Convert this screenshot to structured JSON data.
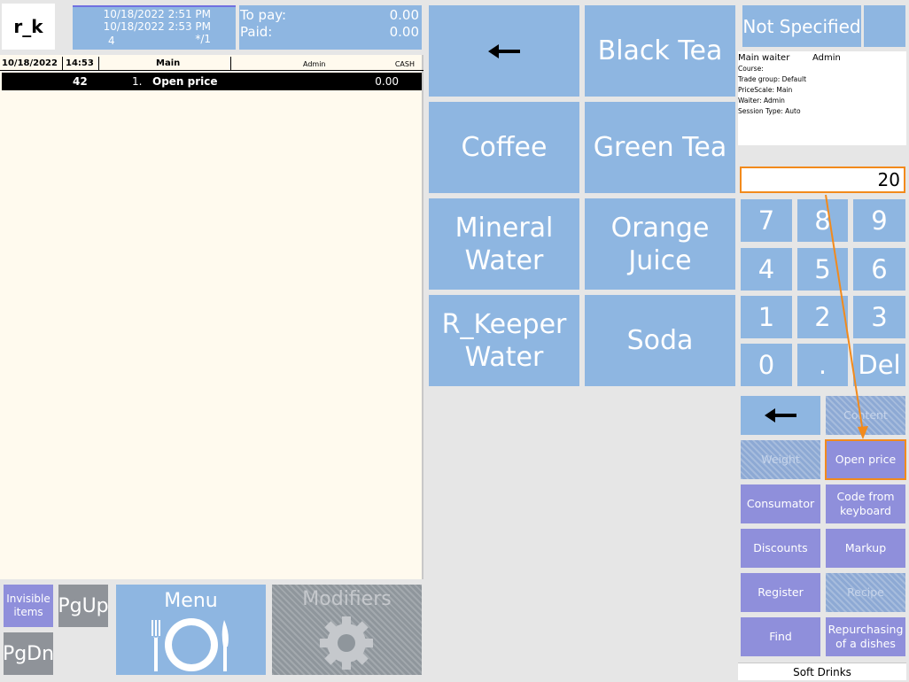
{
  "logo": "r_k",
  "header": {
    "opened": "10/18/2022 2:51 PM",
    "printed": "10/18/2022 2:53 PM",
    "table": "4",
    "guests": "*/1",
    "to_pay_label": "To pay:",
    "to_pay_value": "0.00",
    "paid_label": "Paid:",
    "paid_value": "0.00"
  },
  "order": {
    "header": {
      "date": "10/18/2022",
      "time": "14:53",
      "menu": "Main",
      "waiter": "Admin",
      "currency": "CASH"
    },
    "rows": [
      {
        "code": "42",
        "num": "1.",
        "name": "Open price",
        "price": "0.00"
      }
    ]
  },
  "bottom_left": {
    "invisible_items": "Invisible items",
    "pgup": "PgUp",
    "pgdn": "PgDn",
    "menu": "Menu",
    "modifiers": "Modifiers"
  },
  "menu_items": {
    "back_icon": "arrow-left-icon",
    "black_tea": "Black Tea",
    "coffee": "Coffee",
    "green_tea": "Green Tea",
    "mineral_water": "Mineral Water",
    "orange_juice": "Orange Juice",
    "rkeeper_water": "R_Keeper Water",
    "soda": "Soda"
  },
  "info": {
    "not_specified": "Not Specified",
    "main_waiter_label": "Main waiter",
    "main_waiter_value": "Admin",
    "course": "Course:",
    "trade_group": "Trade group: Default",
    "price_scale": "PriceScale: Main",
    "waiter": "Waiter: Admin",
    "session_type": "Session Type: Auto"
  },
  "numpad": {
    "display": "20",
    "keys": [
      "7",
      "8",
      "9",
      "4",
      "5",
      "6",
      "1",
      "2",
      "3",
      "0",
      ".",
      "Del"
    ]
  },
  "functions": {
    "back_icon": "arrow-left-icon",
    "content": "Content",
    "weight": "Weight",
    "open_price": "Open price",
    "consumator": "Consumator",
    "code_from_keyboard": "Code from keyboard",
    "discounts": "Discounts",
    "markup": "Markup",
    "register": "Register",
    "recipe": "Recipe",
    "find": "Find",
    "repurchasing": "Repurchasing of a dishes"
  },
  "category": "Soft Drinks",
  "colors": {
    "tile": "#8eb6e1",
    "function": "#8f8fdb",
    "highlight": "#f28a1c",
    "order_bg": "#fffaee"
  }
}
